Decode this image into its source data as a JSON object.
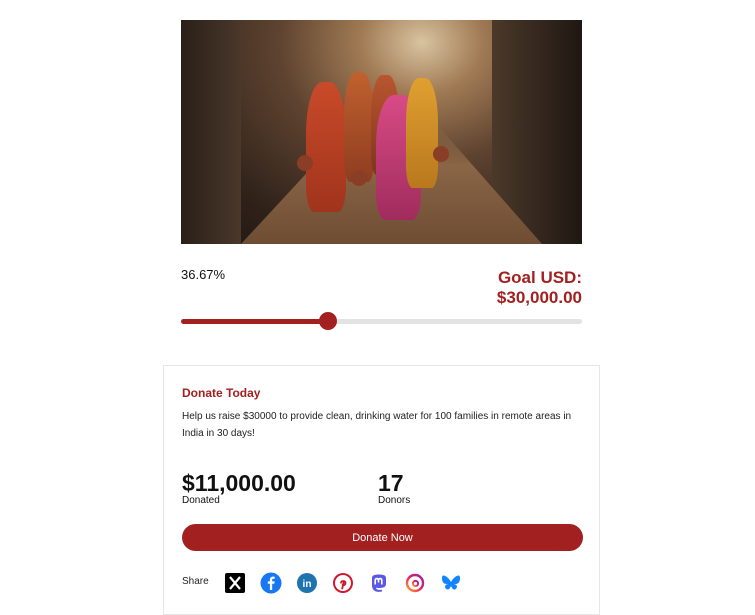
{
  "campaign": {
    "progress_percent_label": "36.67%",
    "progress_fraction": 0.3667,
    "goal_label_line1": "Goal USD:",
    "goal_label_line2": "$30,000.00"
  },
  "donate_card": {
    "title": "Donate Today",
    "description": "Help us raise $30000 to provide clean, drinking water for 100 families in remote areas in India in 30 days!",
    "donated_value": "$11,000.00",
    "donated_label": "Donated",
    "donors_value": "17",
    "donors_label": "Donors",
    "button_label": "Donate Now"
  },
  "share": {
    "label": "Share",
    "icons": [
      "x-icon",
      "facebook-icon",
      "linkedin-icon",
      "pinterest-icon",
      "mastodon-icon",
      "threads-icon",
      "bluesky-icon"
    ]
  },
  "colors": {
    "accent": "#a32020",
    "track": "#e3e3e3"
  }
}
